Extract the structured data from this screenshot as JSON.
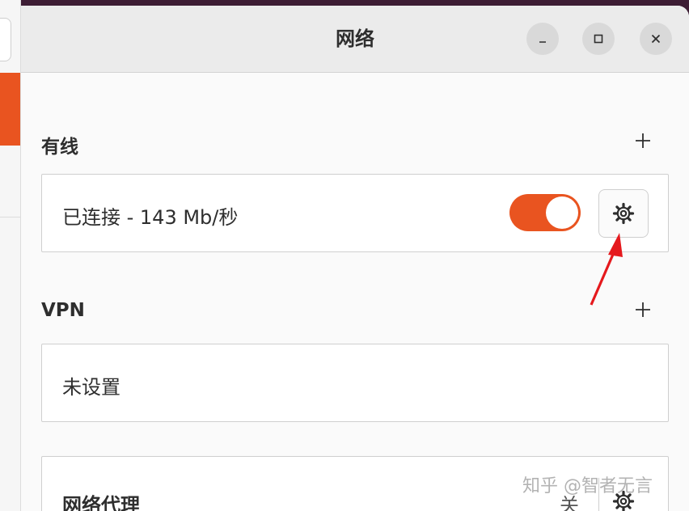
{
  "window": {
    "title": "网络"
  },
  "wired": {
    "label": "有线",
    "connection_status": "已连接 - 143 Mb/秒",
    "enabled": true
  },
  "vpn": {
    "label": "VPN",
    "status": "未设置"
  },
  "proxy": {
    "label": "网络代理",
    "status": "关"
  },
  "watermark": "知乎 @智者无言",
  "colors": {
    "accent": "#e95420",
    "annotation_arrow": "#e5191d"
  }
}
